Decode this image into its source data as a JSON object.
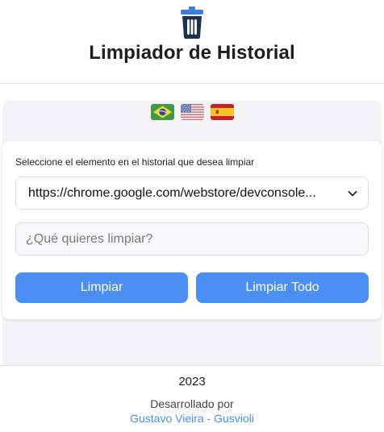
{
  "header": {
    "title": "Limpiador de Historial",
    "logo_icon": "trash-can-icon",
    "logo_color": "#1f2f4f",
    "logo_lid_color": "#3d7ed9"
  },
  "languages": [
    {
      "code": "pt-BR",
      "icon": "brazil-flag-icon"
    },
    {
      "code": "en-US",
      "icon": "usa-flag-icon"
    },
    {
      "code": "es",
      "icon": "spain-flag-icon"
    }
  ],
  "form": {
    "label": "Seleccione el elemento en el historial que desea limpiar",
    "selected_value": "https://chrome.google.com/webstore/devconsole...",
    "input_placeholder": "¿Qué quieres limpiar?",
    "input_value": "",
    "clear_button": "Limpiar",
    "clear_all_button": "Limpiar Todo"
  },
  "footer": {
    "year": "2023",
    "developed_by": "Desarrollado por",
    "author_link": "Gustavo Vieira - Gusvioli"
  },
  "colors": {
    "accent": "#4b8ff5",
    "panel_bg": "#f4f4f6"
  }
}
